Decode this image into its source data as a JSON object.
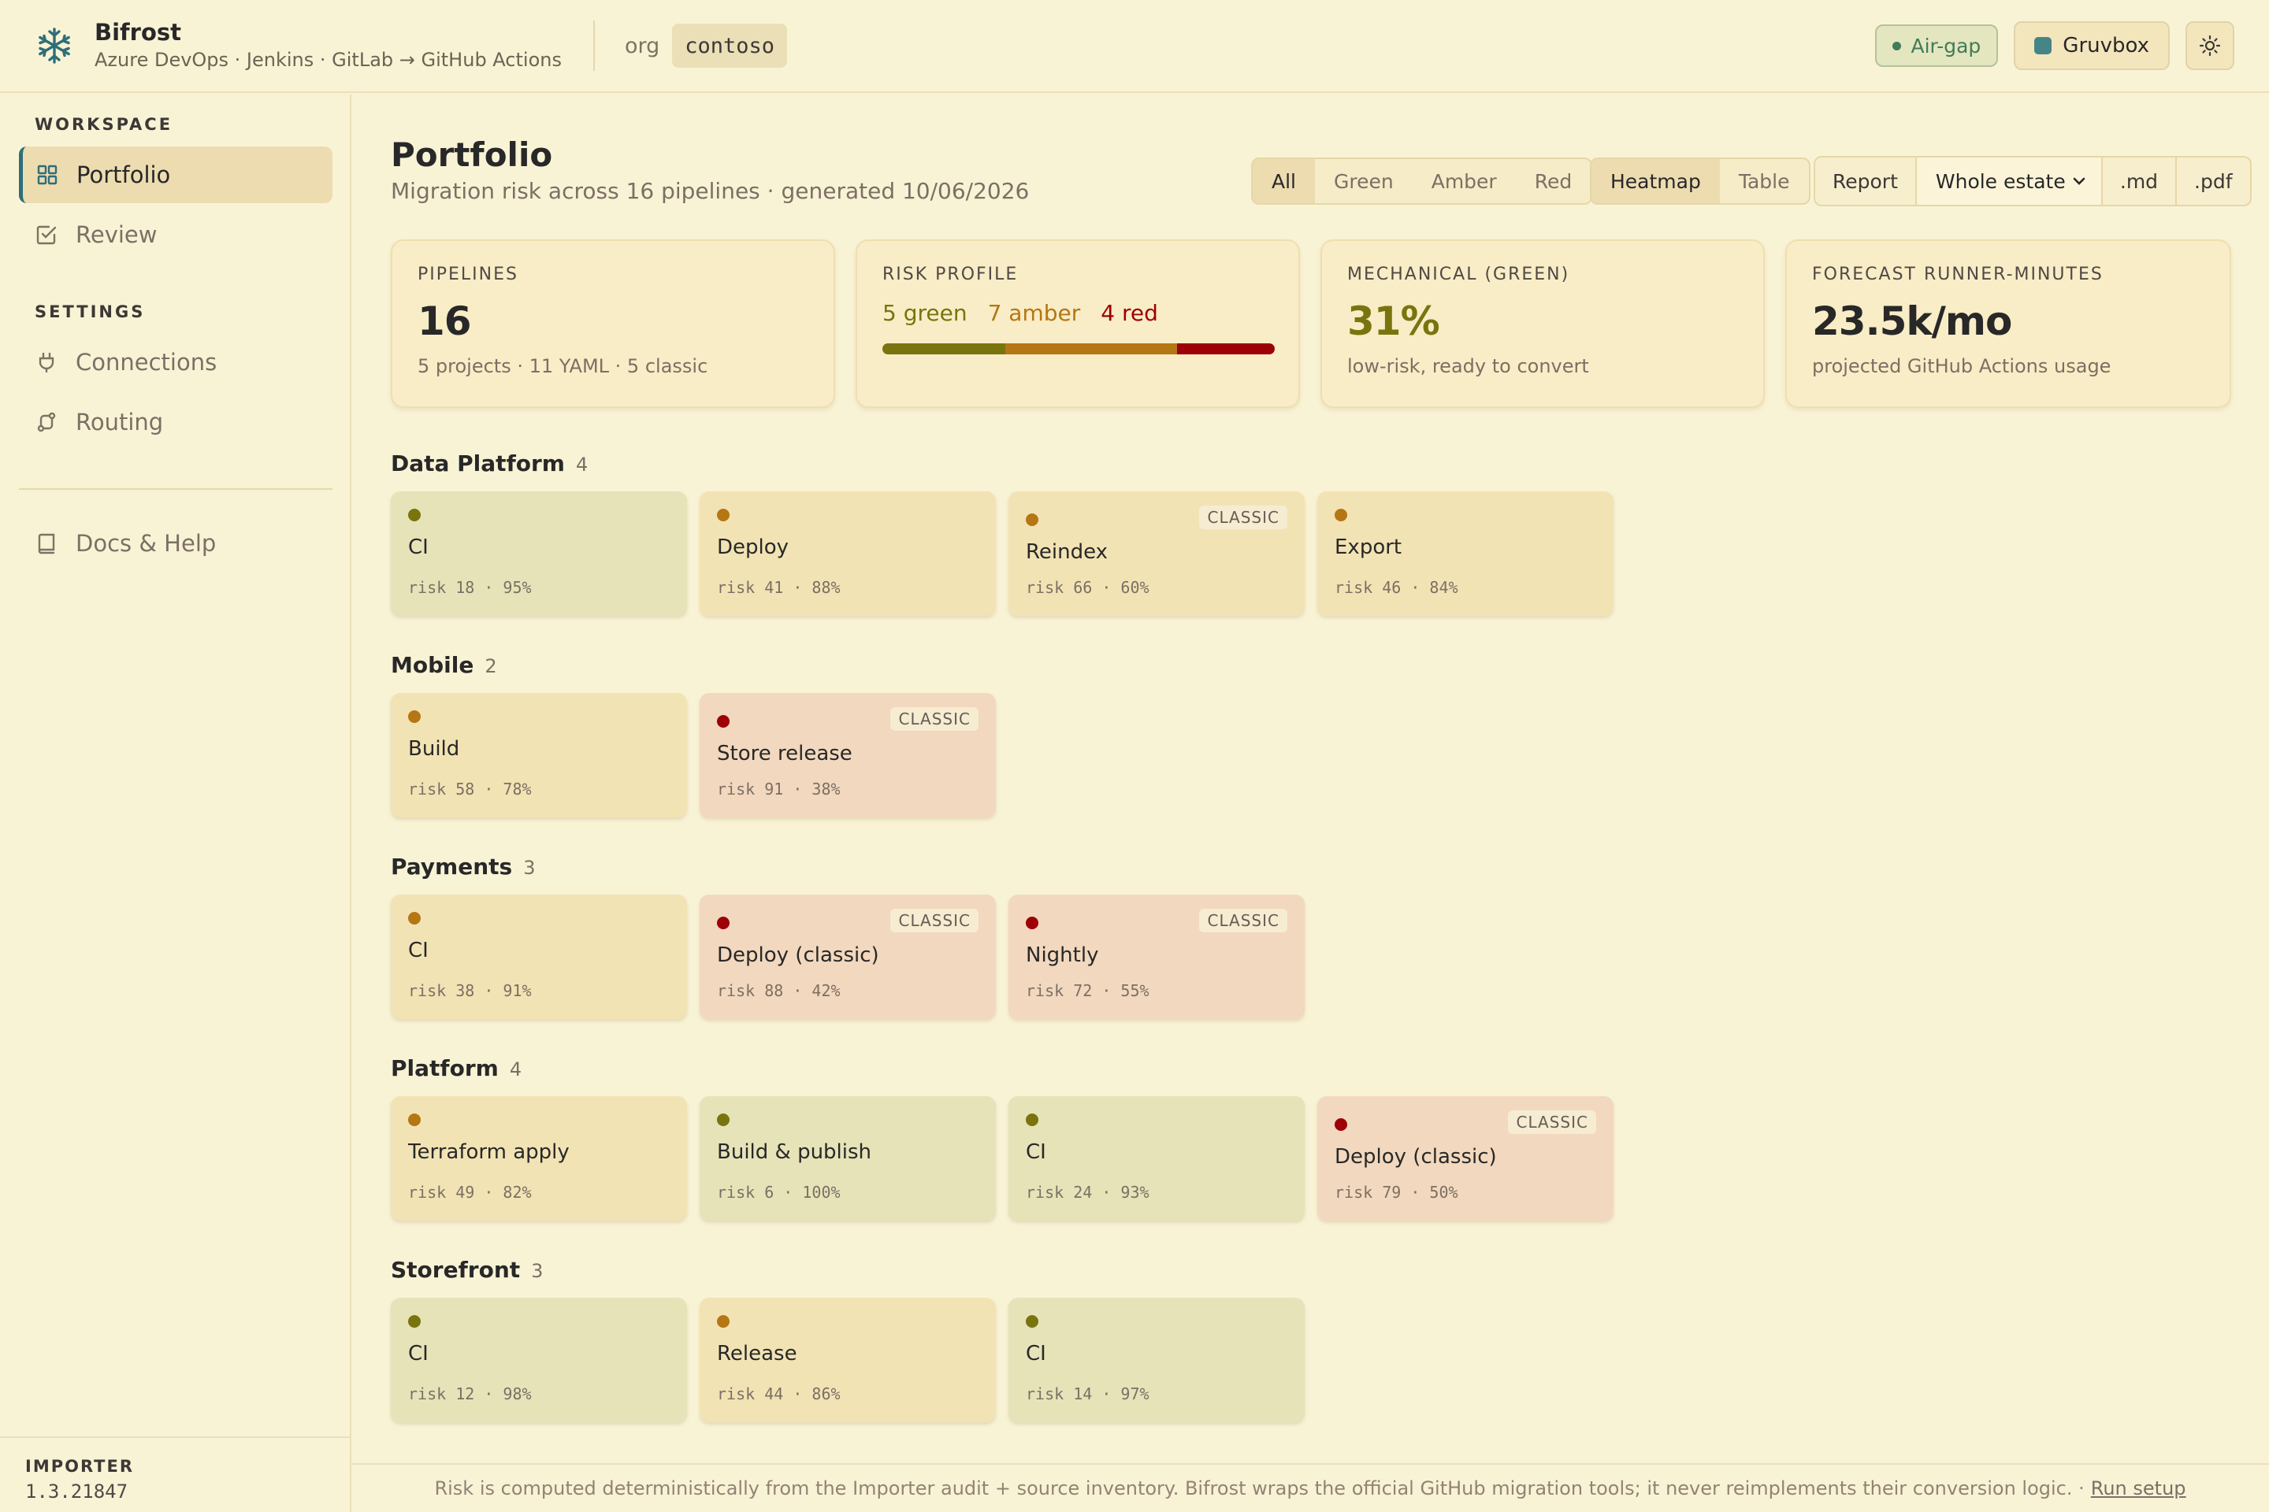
{
  "header": {
    "app_name": "Bifrost",
    "subtitle": "Azure DevOps · Jenkins · GitLab → GitHub Actions",
    "org_label": "org",
    "org_value": "contoso",
    "airgap_label": "Air-gap",
    "theme_label": "Gruvbox",
    "icons": [
      "snowflake-icon",
      "sun-icon"
    ]
  },
  "sidebar": {
    "workspace_label": "WORKSPACE",
    "settings_label": "SETTINGS",
    "items": [
      {
        "label": "Portfolio",
        "icon": "grid-icon",
        "active": true
      },
      {
        "label": "Review",
        "icon": "check-square-icon"
      },
      {
        "label": "Connections",
        "icon": "plug-icon"
      },
      {
        "label": "Routing",
        "icon": "route-icon"
      },
      {
        "label": "Docs & Help",
        "icon": "book-icon"
      }
    ],
    "importer_label": "IMPORTER",
    "importer_version": "1.3.21847"
  },
  "main": {
    "title": "Portfolio",
    "subtitle": "Migration risk across 16 pipelines · generated 10/06/2026",
    "filters": [
      "All",
      "Green",
      "Amber",
      "Red"
    ],
    "filter_selected": "All",
    "views": [
      "Heatmap",
      "Table"
    ],
    "view_selected": "Heatmap",
    "report": {
      "label": "Report",
      "scope": "Whole estate",
      "md": ".md",
      "pdf": ".pdf"
    }
  },
  "stats": {
    "pipelines": {
      "label": "PIPELINES",
      "value": "16",
      "note": "5 projects · 11 YAML · 5 classic"
    },
    "risk_profile": {
      "label": "RISK PROFILE",
      "green": "5 green",
      "amber": "7 amber",
      "red": "4 red",
      "green_count": 5,
      "amber_count": 7,
      "red_count": 4
    },
    "mechanical": {
      "label": "MECHANICAL (GREEN)",
      "value": "31%",
      "note": "low-risk, ready to convert"
    },
    "forecast": {
      "label": "FORECAST RUNNER-MINUTES",
      "value": "23.5k/mo",
      "note": "projected GitHub Actions usage"
    }
  },
  "colors": {
    "green": "#79740e",
    "amber": "#b57614",
    "red": "#9d0006",
    "accent": "#2e6e78",
    "bg": "#f9f3d6"
  },
  "groups": [
    {
      "name": "Data Platform",
      "count": "4",
      "pipelines": [
        {
          "name": "CI",
          "status": "green",
          "meta": "risk 18 · 95%"
        },
        {
          "name": "Deploy",
          "status": "amber",
          "meta": "risk 41 · 88%"
        },
        {
          "name": "Reindex",
          "status": "amber",
          "classic": "CLASSIC",
          "meta": "risk 66 · 60%"
        },
        {
          "name": "Export",
          "status": "amber",
          "meta": "risk 46 · 84%"
        }
      ]
    },
    {
      "name": "Mobile",
      "count": "2",
      "pipelines": [
        {
          "name": "Build",
          "status": "amber",
          "meta": "risk 58 · 78%"
        },
        {
          "name": "Store release",
          "status": "red",
          "classic": "CLASSIC",
          "meta": "risk 91 · 38%"
        }
      ]
    },
    {
      "name": "Payments",
      "count": "3",
      "pipelines": [
        {
          "name": "CI",
          "status": "amber",
          "meta": "risk 38 · 91%"
        },
        {
          "name": "Deploy (classic)",
          "status": "red",
          "classic": "CLASSIC",
          "meta": "risk 88 · 42%"
        },
        {
          "name": "Nightly",
          "status": "red",
          "classic": "CLASSIC",
          "meta": "risk 72 · 55%"
        }
      ]
    },
    {
      "name": "Platform",
      "count": "4",
      "pipelines": [
        {
          "name": "Terraform apply",
          "status": "amber",
          "meta": "risk 49 · 82%"
        },
        {
          "name": "Build & publish",
          "status": "green",
          "meta": "risk 6 · 100%"
        },
        {
          "name": "CI",
          "status": "green",
          "meta": "risk 24 · 93%"
        },
        {
          "name": "Deploy (classic)",
          "status": "red",
          "classic": "CLASSIC",
          "meta": "risk 79 · 50%"
        }
      ]
    },
    {
      "name": "Storefront",
      "count": "3",
      "pipelines": [
        {
          "name": "CI",
          "status": "green",
          "meta": "risk 12 · 98%"
        },
        {
          "name": "Release",
          "status": "amber",
          "meta": "risk 44 · 86%"
        },
        {
          "name": "CI",
          "status": "green",
          "meta": "risk 14 · 97%"
        }
      ]
    }
  ],
  "footer": {
    "text": "Risk is computed deterministically from the Importer audit + source inventory. Bifrost wraps the official GitHub migration tools; it never reimplements their conversion logic. ·",
    "link": "Run setup"
  }
}
